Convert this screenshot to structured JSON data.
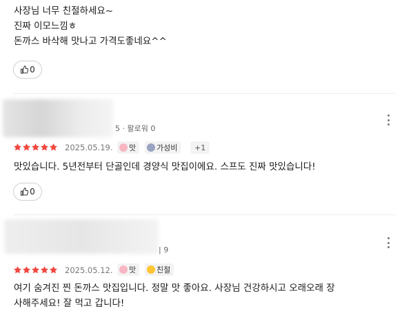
{
  "reviews": [
    {
      "text_lines": [
        "사장님 너무 친절하세요~",
        "진짜 이모느낌ㅎ",
        "돈까스 바삭해 맛나고 가격도좋네요^^"
      ],
      "like_count": "0"
    },
    {
      "author_meta": "5 · 팔로워 0",
      "date": "2025.05.19.",
      "tags": [
        {
          "label": "맛",
          "icon": "tasty-emoji-icon"
        },
        {
          "label": "가성비",
          "icon": "value-emoji-icon"
        }
      ],
      "tags_more": "+1",
      "text_lines": [
        "맛있습니다. 5년전부터 단골인데 경양식 맛집이에요. 스프도 진짜 맛있습니다!"
      ],
      "like_count": "0"
    },
    {
      "author_meta": "| 9",
      "date": "2025.05.12.",
      "tags": [
        {
          "label": "맛",
          "icon": "tasty-emoji-icon"
        },
        {
          "label": "친절",
          "icon": "kind-emoji-icon"
        }
      ],
      "text_lines": [
        "여기 숨겨진 찐 돈까스 맛집입니다. 정말 맛 좋아요. 사장님 건강하시고 오래오래 장",
        "사해주세요! 잘 먹고 갑니다!"
      ]
    }
  ],
  "colors": {
    "star": "#f0473e",
    "divider": "#eeeeee",
    "meta": "#777777"
  }
}
